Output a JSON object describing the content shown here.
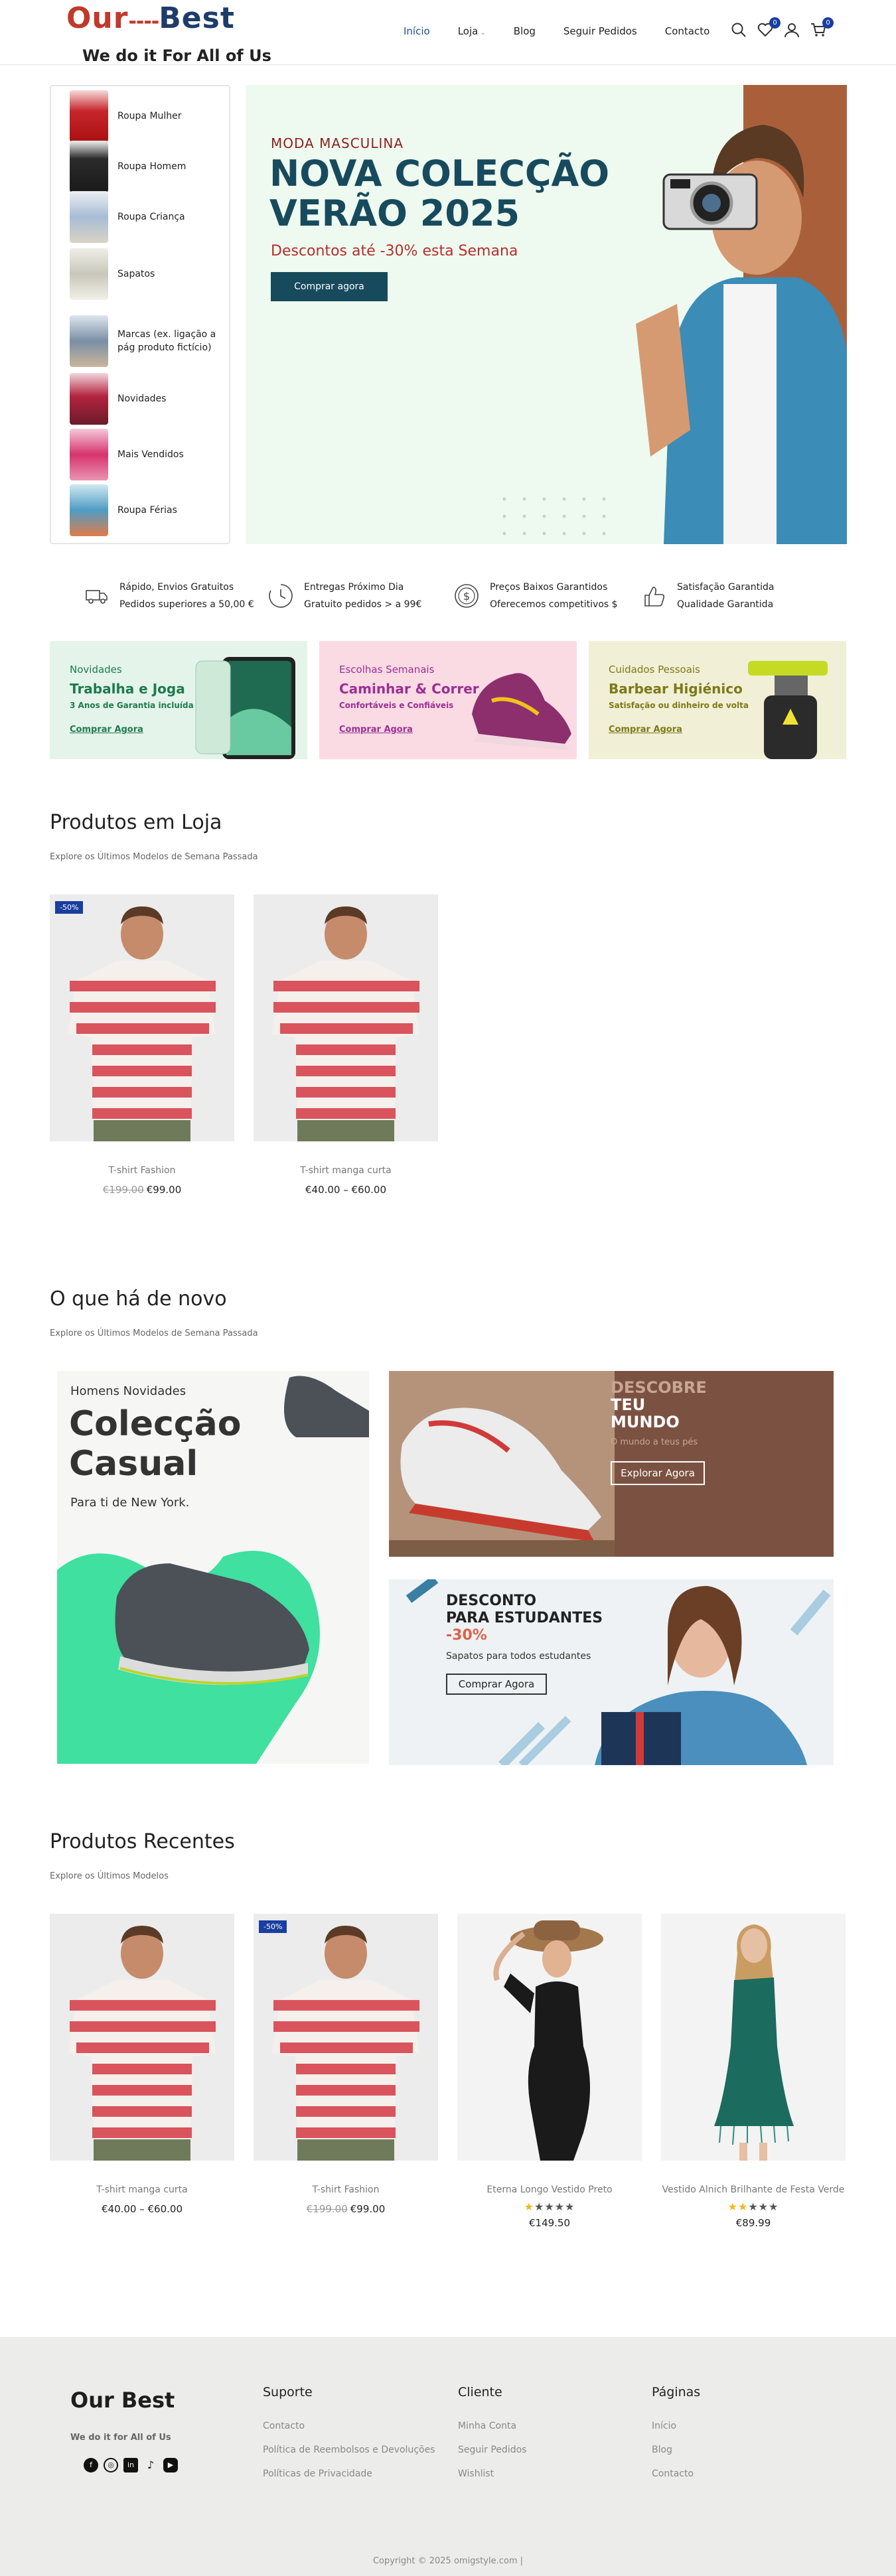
{
  "header": {
    "logo_word1": "Our",
    "logo_dashes": "----",
    "logo_word2": "Best",
    "logo_tagline": "We do it For All of Us",
    "nav": [
      {
        "label": "Início"
      },
      {
        "label": "Loja"
      },
      {
        "label": "Blog"
      },
      {
        "label": "Seguir Pedidos"
      },
      {
        "label": "Contacto"
      }
    ],
    "wishlist_count": "0",
    "cart_count": "0"
  },
  "categories": [
    {
      "label": "Roupa Mulher"
    },
    {
      "label": "Roupa Homem"
    },
    {
      "label": "Roupa Criança"
    },
    {
      "label": "Sapatos"
    },
    {
      "label": "Marcas (ex. ligação a pág produto fictício)"
    },
    {
      "label": "Novidades"
    },
    {
      "label": "Mais Vendidos"
    },
    {
      "label": "Roupa Férias"
    }
  ],
  "hero": {
    "kicker": "MODA MASCULINA",
    "title_line1": "NOVA COLECÇÃO",
    "title_line2": "VERÃO 2025",
    "subtitle": "Descontos até -30% esta Semana",
    "button": "Comprar agora"
  },
  "features": [
    {
      "icon": "truck-icon",
      "line1": "Rápido, Envios Gratuitos",
      "line2": "Pedidos superiores a 50,00 €"
    },
    {
      "icon": "clock-icon",
      "line1": "Entregas Próximo Dia",
      "line2": "Gratuito pedidos > a 99€"
    },
    {
      "icon": "dollar-icon",
      "line1": "Preços Baixos Garantidos",
      "line2": "Oferecemos competitivos $"
    },
    {
      "icon": "thumbs-up-icon",
      "line1": "Satisfação Garantida",
      "line2": "Qualidade Garantida"
    }
  ],
  "promos": [
    {
      "kicker": "Novidades",
      "title": "Trabalha e Joga",
      "sub": "3 Anos de Garantia incluída",
      "link": "Comprar Agora",
      "bg": "#e4f4ea",
      "accent": "#1e7a4d"
    },
    {
      "kicker": "Escolhas Semanais",
      "title": "Caminhar & Correr",
      "sub": "Confortáveis e Confiáveis",
      "link": "Comprar Agora",
      "bg": "#fbdbe3",
      "accent": "#9b2f94"
    },
    {
      "kicker": "Cuidados Pessoais",
      "title": "Barbear Higiénico",
      "sub": "Satisfação ou dinheiro de volta",
      "link": "Comprar Agora",
      "bg": "#f1efd6",
      "accent": "#7c7a16"
    }
  ],
  "sections": {
    "store_title": "Produtos em Loja",
    "store_sub": "Explore os Últimos Modelos de Semana Passada",
    "new_title": "O que há de novo",
    "new_sub": "Explore os Últimos Modelos de Semana Passada",
    "recent_title": "Produtos Recentes",
    "recent_sub": "Explore os Últimos Modelos"
  },
  "store_products": [
    {
      "name": "T-shirt Fashion",
      "old_price": "€199.00",
      "price": "€99.00",
      "sale": "-50%"
    },
    {
      "name": "T-shirt manga curta",
      "old_price": "",
      "price": "€40.00 – €60.00",
      "sale": ""
    }
  ],
  "banners": {
    "casual_kicker": "Homens Novidades",
    "casual_title1": "Colecção",
    "casual_title2": "Casual",
    "casual_sub": "Para ti de New York.",
    "world_title1": "DESCOBRE",
    "world_title2": "TEU",
    "world_title3": "MUNDO",
    "world_sub": "O mundo a teus pés",
    "world_button": "Explorar Agora",
    "student_title1": "DESCONTO",
    "student_title2": "PARA ESTUDANTES",
    "student_pct": "-30%",
    "student_sub": "Sapatos para todos estudantes",
    "student_button": "Comprar Agora"
  },
  "recent_products": [
    {
      "name": "T-shirt manga curta",
      "old_price": "",
      "price": "€40.00 – €60.00",
      "sale": "",
      "rating": 0
    },
    {
      "name": "T-shirt Fashion",
      "old_price": "€199.00",
      "price": "€99.00",
      "sale": "-50%",
      "rating": 0
    },
    {
      "name": "Eterna Longo Vestido Preto",
      "old_price": "",
      "price": "€149.50",
      "sale": "",
      "rating": 1
    },
    {
      "name": "Vestido Alnich Brilhante de Festa Verde",
      "old_price": "",
      "price": "€89.99",
      "sale": "",
      "rating": 2
    }
  ],
  "footer": {
    "logo": "Our Best",
    "tagline": "We do it for All of Us",
    "col1_title": "Suporte",
    "col1_links": [
      "Contacto",
      "Política de Reembolsos e Devoluções",
      "Políticas de Privacidade"
    ],
    "col2_title": "Cliente",
    "col2_links": [
      "Minha Conta",
      "Seguir Pedidos",
      "Wishlist"
    ],
    "col3_title": "Páginas",
    "col3_links": [
      "Início",
      "Blog",
      "Contacto"
    ],
    "social": [
      "facebook-icon",
      "instagram-icon",
      "linkedin-icon",
      "tiktok-icon",
      "youtube-icon"
    ],
    "copyright": "Copyright © 2025 omigstyle.com |"
  },
  "colors": {
    "accent_blue": "#1a3ea0",
    "hero_teal": "#174a5d",
    "logo_red": "#c0392b"
  }
}
